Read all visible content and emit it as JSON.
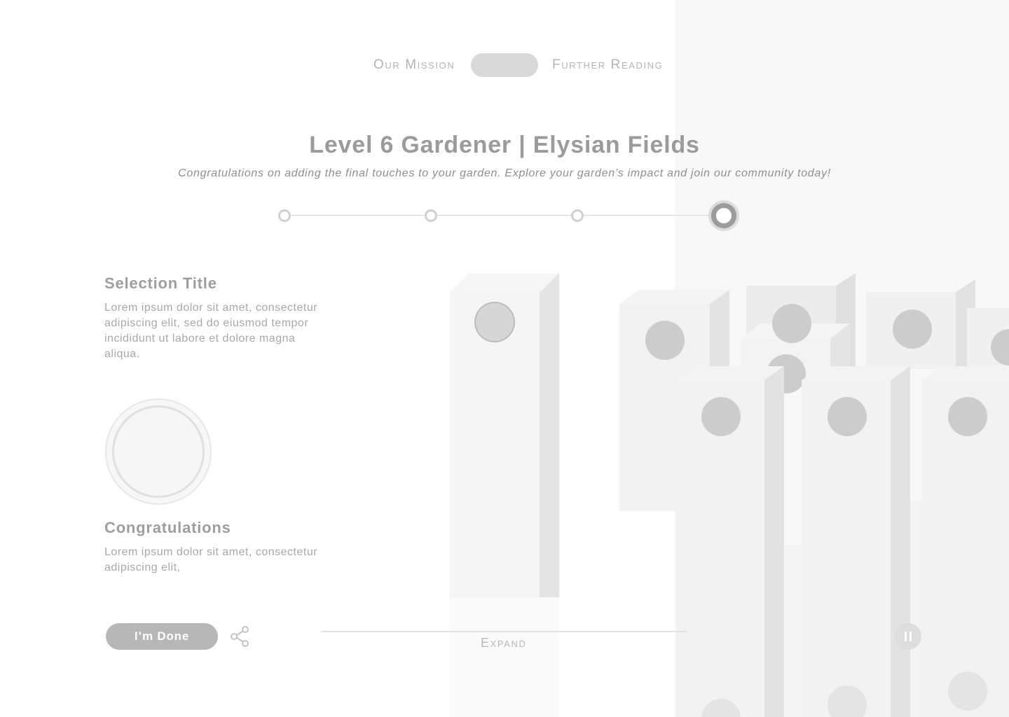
{
  "nav": {
    "mission_label": "Our Mission",
    "reading_label": "Further Reading"
  },
  "header": {
    "title": "Level 6 Gardener | Elysian Fields",
    "subtitle": "Congratulations on adding the final touches to your garden. Explore your garden’s impact and join our community today!"
  },
  "stepper": {
    "total_steps": 4,
    "active_step": 4
  },
  "selection": {
    "title": "Selection Title",
    "body": "Lorem ipsum dolor sit amet, consectetur adipiscing elit, sed do eiusmod tempor incididunt ut labore et dolore magna aliqua."
  },
  "congratulations": {
    "title": "Congratulations",
    "body": "Lorem ipsum dolor sit amet, consectetur adipiscing elit,"
  },
  "actions": {
    "done_label": "I’m Done",
    "expand_label": "Expand"
  },
  "icons": {
    "share": "share-icon",
    "pause": "pause-icon",
    "badge": "badge-icon"
  },
  "colors": {
    "text_gray": "#9b9b9b",
    "pill_gray": "#d9d9d9",
    "button_gray": "#b7b7b7",
    "panel_bg": "#f8f8f8",
    "dot_gray": "#cccccc"
  }
}
